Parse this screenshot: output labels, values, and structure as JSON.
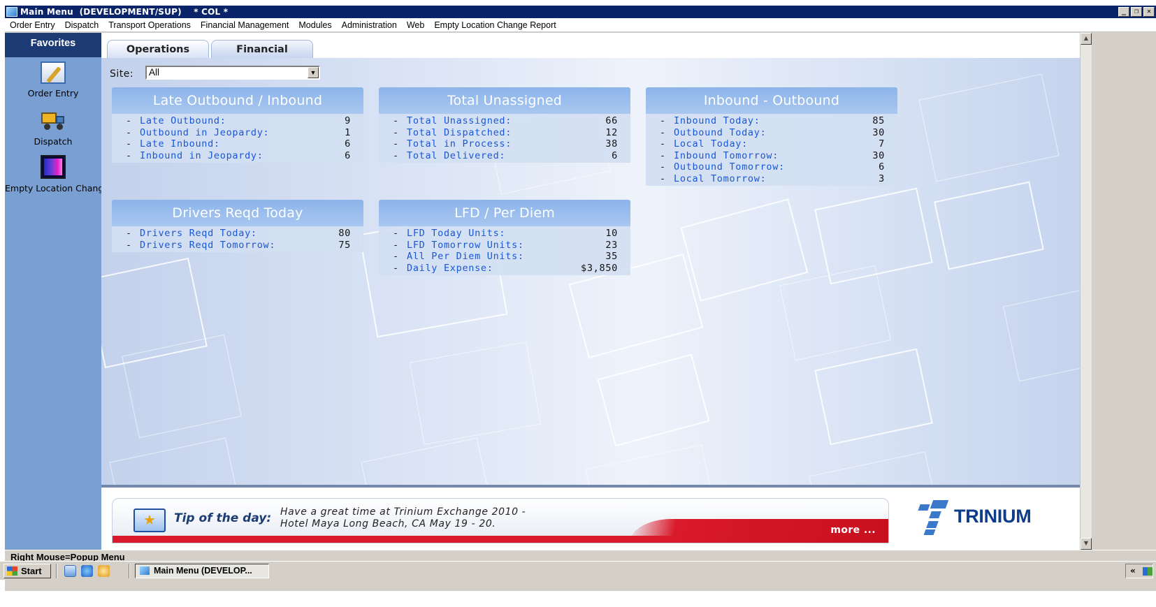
{
  "window": {
    "title": "Main Menu  (DEVELOPMENT/SUP)    * COL *",
    "controls": [
      "minimize",
      "restore",
      "close"
    ]
  },
  "menubar": {
    "items": [
      "Order Entry",
      "Dispatch",
      "Transport Operations",
      "Financial Management",
      "Modules",
      "Administration",
      "Web",
      "Empty Location Change Report"
    ]
  },
  "favorites": {
    "header": "Favorites",
    "items": [
      {
        "label": "Order Entry",
        "icon": "order-entry-icon"
      },
      {
        "label": "Dispatch",
        "icon": "truck-icon"
      },
      {
        "label": "Empty Location Change Report",
        "icon": "empty-location-icon"
      }
    ]
  },
  "tabs": [
    {
      "label": "Operations",
      "active": true
    },
    {
      "label": "Financial",
      "active": false
    }
  ],
  "site": {
    "label": "Site:",
    "value": "All"
  },
  "panels": [
    {
      "title": "Late Outbound / Inbound",
      "rows": [
        {
          "label": "Late Outbound:",
          "value": "9"
        },
        {
          "label": "Outbound in Jeopardy:",
          "value": "1"
        },
        {
          "label": "Late Inbound:",
          "value": "6"
        },
        {
          "label": "Inbound in Jeopardy:",
          "value": "6"
        }
      ]
    },
    {
      "title": "Total Unassigned",
      "rows": [
        {
          "label": "Total Unassigned:",
          "value": "66"
        },
        {
          "label": "Total Dispatched:",
          "value": "12"
        },
        {
          "label": "Total in Process:",
          "value": "38"
        },
        {
          "label": "Total Delivered:",
          "value": "6"
        }
      ]
    },
    {
      "title": "Inbound - Outbound",
      "rows": [
        {
          "label": "Inbound Today:",
          "value": "85"
        },
        {
          "label": "Outbound Today:",
          "value": "30"
        },
        {
          "label": "Local Today:",
          "value": "7"
        },
        {
          "label": "Inbound Tomorrow:",
          "value": "30"
        },
        {
          "label": "Outbound Tomorrow:",
          "value": "6"
        },
        {
          "label": "Local Tomorrow:",
          "value": "3"
        }
      ]
    },
    {
      "title": "Drivers Reqd Today",
      "rows": [
        {
          "label": "Drivers Reqd Today:",
          "value": "80"
        },
        {
          "label": "Drivers Reqd Tomorrow:",
          "value": "75"
        }
      ]
    },
    {
      "title": "LFD / Per Diem",
      "rows": [
        {
          "label": "LFD Today Units:",
          "value": "10"
        },
        {
          "label": "LFD Tomorrow Units:",
          "value": "23"
        },
        {
          "label": "All Per Diem Units:",
          "value": "35"
        },
        {
          "label": "Daily Expense:",
          "value": "$3,850"
        }
      ]
    }
  ],
  "tip": {
    "title": "Tip of the day:",
    "line1": "Have a great time at Trinium Exchange 2010 -",
    "line2": "Hotel Maya Long Beach, CA May 19 - 20.",
    "more": "more ..."
  },
  "logo": {
    "text": "TRINIUM"
  },
  "statusbar": {
    "text": "Right Mouse=Popup Menu"
  },
  "taskbar": {
    "start": "Start",
    "task": "Main Menu  (DEVELOP...",
    "tray": "«"
  },
  "colors": {
    "titlebar": "#0a246a",
    "favorites_header": "#1c3b75",
    "sidebar": "#7a9fd2",
    "panel_header": "#8cb4ea",
    "link_text": "#1a57d6",
    "tip_red": "#d91a2a"
  }
}
